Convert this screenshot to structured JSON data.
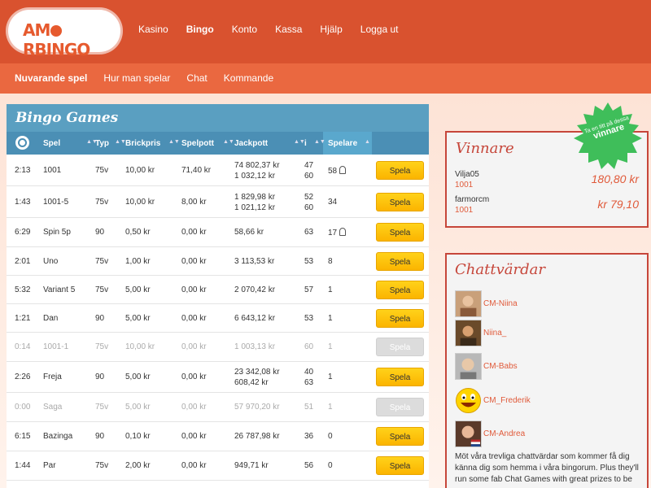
{
  "brand": {
    "logo_part1": "AM",
    "logo_part2": "RBINGO"
  },
  "topnav": [
    {
      "label": "Kasino",
      "active": false
    },
    {
      "label": "Bingo",
      "active": true
    },
    {
      "label": "Konto",
      "active": false
    },
    {
      "label": "Kassa",
      "active": false
    },
    {
      "label": "Hjälp",
      "active": false
    },
    {
      "label": "Logga ut",
      "active": false
    }
  ],
  "subnav": [
    {
      "label": "Nuvarande spel",
      "active": true
    },
    {
      "label": "Hur man spelar",
      "active": false
    },
    {
      "label": "Chat",
      "active": false
    },
    {
      "label": "Kommande",
      "active": false
    }
  ],
  "games": {
    "title": "Bingo Games",
    "columns": [
      "Spel",
      "Typ",
      "Brickpris",
      "Spelpott",
      "Jackpott",
      "i",
      "Spelare"
    ],
    "rows": [
      {
        "time": "2:13",
        "name": "1001",
        "type": "75v",
        "price": "10,00 kr",
        "pot": "71,40 kr",
        "jackpot": [
          "74 802,37 kr",
          "1 032,12 kr"
        ],
        "i": [
          "47",
          "60"
        ],
        "players": "58",
        "player_icon": true,
        "button": "Spela",
        "disabled": false
      },
      {
        "time": "1:43",
        "name": "1001-5",
        "type": "75v",
        "price": "10,00 kr",
        "pot": "8,00 kr",
        "jackpot": [
          "1 829,98 kr",
          "1 021,12 kr"
        ],
        "i": [
          "52",
          "60"
        ],
        "players": "34",
        "player_icon": false,
        "button": "Spela",
        "disabled": false
      },
      {
        "time": "6:29",
        "name": "Spin 5p",
        "type": "90",
        "price": "0,50 kr",
        "pot": "0,00 kr",
        "jackpot": [
          "58,66 kr"
        ],
        "i": [
          "63"
        ],
        "players": "17",
        "player_icon": true,
        "button": "Spela",
        "disabled": false
      },
      {
        "time": "2:01",
        "name": "Uno",
        "type": "75v",
        "price": "1,00 kr",
        "pot": "0,00 kr",
        "jackpot": [
          "3 113,53 kr"
        ],
        "i": [
          "53"
        ],
        "players": "8",
        "player_icon": false,
        "button": "Spela",
        "disabled": false
      },
      {
        "time": "5:32",
        "name": "Variant 5",
        "type": "75v",
        "price": "5,00 kr",
        "pot": "0,00 kr",
        "jackpot": [
          "2 070,42 kr"
        ],
        "i": [
          "57"
        ],
        "players": "1",
        "player_icon": false,
        "button": "Spela",
        "disabled": false
      },
      {
        "time": "1:21",
        "name": "Dan",
        "type": "90",
        "price": "5,00 kr",
        "pot": "0,00 kr",
        "jackpot": [
          "6 643,12 kr"
        ],
        "i": [
          "53"
        ],
        "players": "1",
        "player_icon": false,
        "button": "Spela",
        "disabled": false
      },
      {
        "time": "0:14",
        "name": "1001-1",
        "type": "75v",
        "price": "10,00 kr",
        "pot": "0,00 kr",
        "jackpot": [
          "1 003,13 kr"
        ],
        "i": [
          "60"
        ],
        "players": "1",
        "player_icon": false,
        "button": "Spela",
        "disabled": true
      },
      {
        "time": "2:26",
        "name": "Freja",
        "type": "90",
        "price": "5,00 kr",
        "pot": "0,00 kr",
        "jackpot": [
          "23 342,08 kr",
          "608,42 kr"
        ],
        "i": [
          "40",
          "63"
        ],
        "players": "1",
        "player_icon": false,
        "button": "Spela",
        "disabled": false
      },
      {
        "time": "0:00",
        "name": "Saga",
        "type": "75v",
        "price": "5,00 kr",
        "pot": "0,00 kr",
        "jackpot": [
          "57 970,20 kr"
        ],
        "i": [
          "51"
        ],
        "players": "1",
        "player_icon": false,
        "button": "Spela",
        "disabled": true
      },
      {
        "time": "6:15",
        "name": "Bazinga",
        "type": "90",
        "price": "0,10 kr",
        "pot": "0,00 kr",
        "jackpot": [
          "26 787,98 kr"
        ],
        "i": [
          "36"
        ],
        "players": "0",
        "player_icon": false,
        "button": "Spela",
        "disabled": false
      },
      {
        "time": "1:44",
        "name": "Par",
        "type": "75v",
        "price": "2,00 kr",
        "pot": "0,00 kr",
        "jackpot": [
          "949,71 kr"
        ],
        "i": [
          "56"
        ],
        "players": "0",
        "player_icon": false,
        "button": "Spela",
        "disabled": false
      }
    ]
  },
  "winners": {
    "title": "Vinnare",
    "seal_small": "Ta en titt på dessa",
    "seal_big": "vinnare",
    "items": [
      {
        "name": "Vilja05",
        "game": "1001",
        "amount": "180,80 kr"
      },
      {
        "name": "farmorcm",
        "game": "1001",
        "amount": "kr 79,10"
      }
    ]
  },
  "chat": {
    "title": "Chattvärdar",
    "hosts": [
      {
        "name": "CM-Niina",
        "avatar": "photo"
      },
      {
        "name": "Niina_",
        "avatar": "photo"
      },
      {
        "name": "CM-Babs",
        "avatar": "photo"
      },
      {
        "name": "CM_Frederik",
        "avatar": "smiley"
      },
      {
        "name": "CM-Andrea",
        "avatar": "photo-flag"
      }
    ],
    "text": "Möt våra trevliga chattvärdar som kommer få dig känna dig som hemma i våra bingorum. Plus they'll run some fab Chat Games with great prizes to be"
  },
  "colors": {
    "brand_orange": "#d9522f",
    "table_blue": "#4b8fb5",
    "button_yellow": "#fbb400",
    "accent_red": "#c6463a"
  }
}
